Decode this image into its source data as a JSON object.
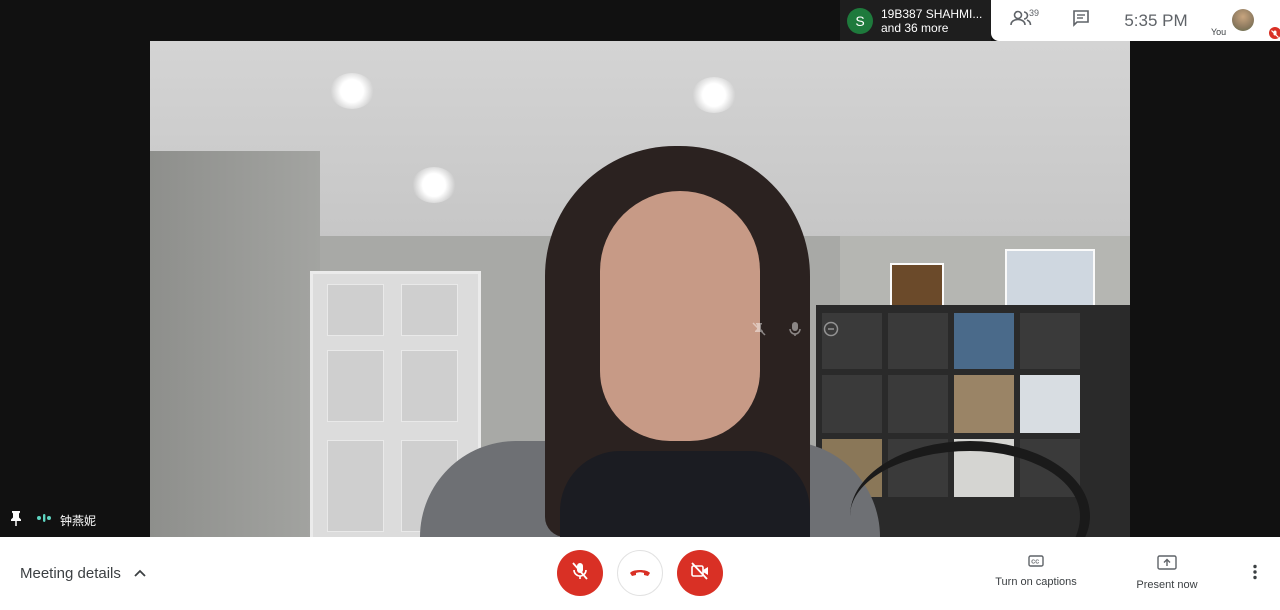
{
  "top_right": {
    "participant_name": "19B387 SHAHMI...",
    "participant_more": "and 36 more",
    "participant_initial": "S",
    "people_count": "39",
    "time": "5:35 PM",
    "self_label": "You"
  },
  "speaker": {
    "name": "钟燕妮"
  },
  "bottom_bar": {
    "meeting_details": "Meeting details",
    "captions_label": "Turn on captions",
    "present_label": "Present now"
  },
  "colors": {
    "accent_red": "#d93025",
    "avatar_green": "#1e7a3c"
  }
}
